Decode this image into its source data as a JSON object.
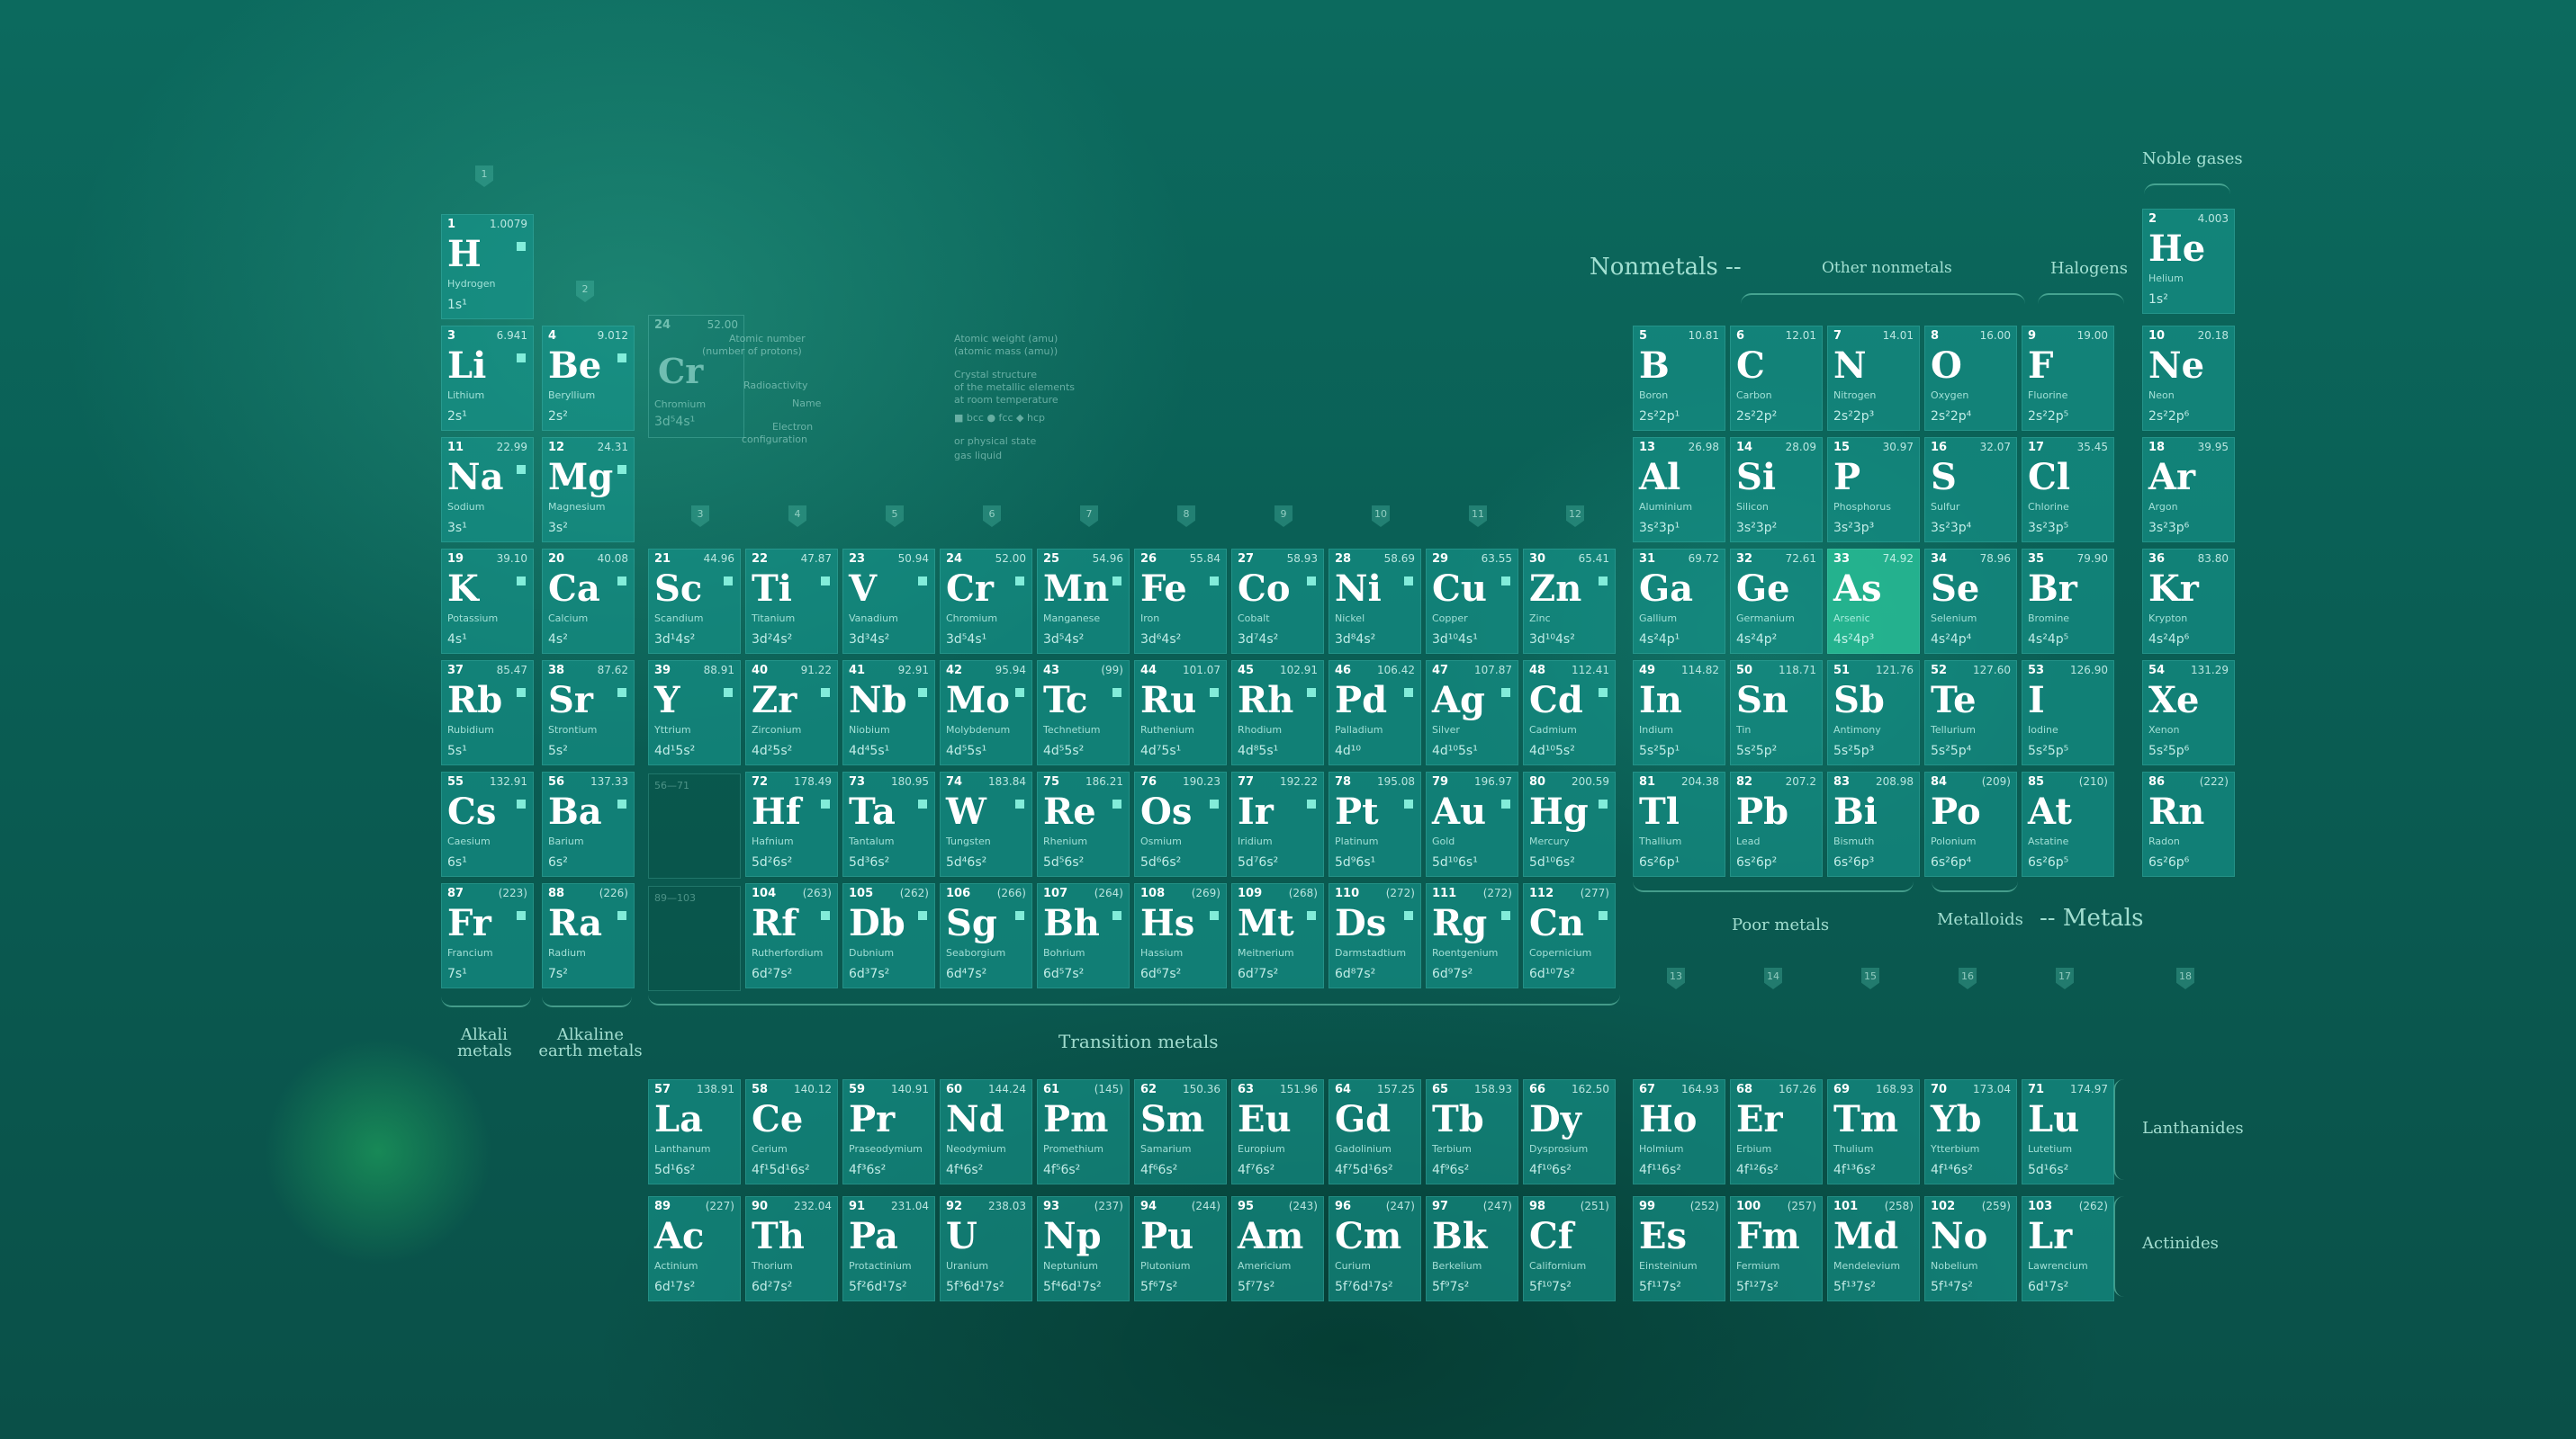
{
  "group_numbers": [
    "1",
    "2",
    "3",
    "4",
    "5",
    "6",
    "7",
    "8",
    "9",
    "10",
    "11",
    "12",
    "13",
    "14",
    "15",
    "16",
    "17",
    "18"
  ],
  "labels": {
    "noble_gases": "Noble gases",
    "nonmetals": "Nonmetals --",
    "other_nonmetals": "Other nonmetals",
    "halogens": "Halogens",
    "alkali": "Alkali metals",
    "alkaline": "Alkaline earth metals",
    "transition": "Transition metals",
    "poor": "Poor metals",
    "metalloids": "Metalloids",
    "metals": "-- Metals",
    "lanthanides": "Lanthanides",
    "actinides": "Actinides",
    "lanth_range": "56—71",
    "act_range": "89—103"
  },
  "legend": {
    "symbol": "Cr",
    "number": "24",
    "weight": "52.00",
    "name": "Chromium",
    "config": "3d⁵4s¹",
    "atomic_number": "Atomic number",
    "atomic_number_sub": "(number of protons)",
    "radioactivity": "Radioactivity",
    "name_label": "Name",
    "electron_label": "Electron",
    "configuration": "configuration",
    "atomic_weight": "Atomic weight (amu)",
    "atomic_weight_sub": "(atomic mass (amu))",
    "crystal1": "Crystal structure",
    "crystal2": "of the metallic elements",
    "crystal3": "at room temperature",
    "crystal_types": "■ bcc  ● fcc  ◆ hcp",
    "state": "or physical state",
    "state_types": "gas   liquid"
  },
  "elements": [
    {
      "n": "1",
      "s": "H",
      "name": "Hydrogen",
      "w": "1.0079",
      "e": "1s¹",
      "r": 1,
      "c": 1
    },
    {
      "n": "2",
      "s": "He",
      "name": "Helium",
      "w": "4.003",
      "e": "1s²",
      "r": 1,
      "c": 18
    },
    {
      "n": "3",
      "s": "Li",
      "name": "Lithium",
      "w": "6.941",
      "e": "2s¹",
      "r": 2,
      "c": 1
    },
    {
      "n": "4",
      "s": "Be",
      "name": "Beryllium",
      "w": "9.012",
      "e": "2s²",
      "r": 2,
      "c": 2
    },
    {
      "n": "5",
      "s": "B",
      "name": "Boron",
      "w": "10.81",
      "e": "2s²2p¹",
      "r": 2,
      "c": 13
    },
    {
      "n": "6",
      "s": "C",
      "name": "Carbon",
      "w": "12.01",
      "e": "2s²2p²",
      "r": 2,
      "c": 14
    },
    {
      "n": "7",
      "s": "N",
      "name": "Nitrogen",
      "w": "14.01",
      "e": "2s²2p³",
      "r": 2,
      "c": 15
    },
    {
      "n": "8",
      "s": "O",
      "name": "Oxygen",
      "w": "16.00",
      "e": "2s²2p⁴",
      "r": 2,
      "c": 16
    },
    {
      "n": "9",
      "s": "F",
      "name": "Fluorine",
      "w": "19.00",
      "e": "2s²2p⁵",
      "r": 2,
      "c": 17
    },
    {
      "n": "10",
      "s": "Ne",
      "name": "Neon",
      "w": "20.18",
      "e": "2s²2p⁶",
      "r": 2,
      "c": 18
    },
    {
      "n": "11",
      "s": "Na",
      "name": "Sodium",
      "w": "22.99",
      "e": "3s¹",
      "r": 3,
      "c": 1
    },
    {
      "n": "12",
      "s": "Mg",
      "name": "Magnesium",
      "w": "24.31",
      "e": "3s²",
      "r": 3,
      "c": 2
    },
    {
      "n": "13",
      "s": "Al",
      "name": "Aluminium",
      "w": "26.98",
      "e": "3s²3p¹",
      "r": 3,
      "c": 13
    },
    {
      "n": "14",
      "s": "Si",
      "name": "Silicon",
      "w": "28.09",
      "e": "3s²3p²",
      "r": 3,
      "c": 14
    },
    {
      "n": "15",
      "s": "P",
      "name": "Phosphorus",
      "w": "30.97",
      "e": "3s²3p³",
      "r": 3,
      "c": 15
    },
    {
      "n": "16",
      "s": "S",
      "name": "Sulfur",
      "w": "32.07",
      "e": "3s²3p⁴",
      "r": 3,
      "c": 16
    },
    {
      "n": "17",
      "s": "Cl",
      "name": "Chlorine",
      "w": "35.45",
      "e": "3s²3p⁵",
      "r": 3,
      "c": 17
    },
    {
      "n": "18",
      "s": "Ar",
      "name": "Argon",
      "w": "39.95",
      "e": "3s²3p⁶",
      "r": 3,
      "c": 18
    },
    {
      "n": "19",
      "s": "K",
      "name": "Potassium",
      "w": "39.10",
      "e": "4s¹",
      "r": 4,
      "c": 1
    },
    {
      "n": "20",
      "s": "Ca",
      "name": "Calcium",
      "w": "40.08",
      "e": "4s²",
      "r": 4,
      "c": 2
    },
    {
      "n": "21",
      "s": "Sc",
      "name": "Scandium",
      "w": "44.96",
      "e": "3d¹4s²",
      "r": 4,
      "c": 3
    },
    {
      "n": "22",
      "s": "Ti",
      "name": "Titanium",
      "w": "47.87",
      "e": "3d²4s²",
      "r": 4,
      "c": 4
    },
    {
      "n": "23",
      "s": "V",
      "name": "Vanadium",
      "w": "50.94",
      "e": "3d³4s²",
      "r": 4,
      "c": 5
    },
    {
      "n": "24",
      "s": "Cr",
      "name": "Chromium",
      "w": "52.00",
      "e": "3d⁵4s¹",
      "r": 4,
      "c": 6
    },
    {
      "n": "25",
      "s": "Mn",
      "name": "Manganese",
      "w": "54.96",
      "e": "3d⁵4s²",
      "r": 4,
      "c": 7
    },
    {
      "n": "26",
      "s": "Fe",
      "name": "Iron",
      "w": "55.84",
      "e": "3d⁶4s²",
      "r": 4,
      "c": 8
    },
    {
      "n": "27",
      "s": "Co",
      "name": "Cobalt",
      "w": "58.93",
      "e": "3d⁷4s²",
      "r": 4,
      "c": 9
    },
    {
      "n": "28",
      "s": "Ni",
      "name": "Nickel",
      "w": "58.69",
      "e": "3d⁸4s²",
      "r": 4,
      "c": 10
    },
    {
      "n": "29",
      "s": "Cu",
      "name": "Copper",
      "w": "63.55",
      "e": "3d¹⁰4s¹",
      "r": 4,
      "c": 11
    },
    {
      "n": "30",
      "s": "Zn",
      "name": "Zinc",
      "w": "65.41",
      "e": "3d¹⁰4s²",
      "r": 4,
      "c": 12
    },
    {
      "n": "31",
      "s": "Ga",
      "name": "Gallium",
      "w": "69.72",
      "e": "4s²4p¹",
      "r": 4,
      "c": 13
    },
    {
      "n": "32",
      "s": "Ge",
      "name": "Germanium",
      "w": "72.61",
      "e": "4s²4p²",
      "r": 4,
      "c": 14
    },
    {
      "n": "33",
      "s": "As",
      "name": "Arsenic",
      "w": "74.92",
      "e": "4s²4p³",
      "r": 4,
      "c": 15,
      "hl": true
    },
    {
      "n": "34",
      "s": "Se",
      "name": "Selenium",
      "w": "78.96",
      "e": "4s²4p⁴",
      "r": 4,
      "c": 16
    },
    {
      "n": "35",
      "s": "Br",
      "name": "Bromine",
      "w": "79.90",
      "e": "4s²4p⁵",
      "r": 4,
      "c": 17
    },
    {
      "n": "36",
      "s": "Kr",
      "name": "Krypton",
      "w": "83.80",
      "e": "4s²4p⁶",
      "r": 4,
      "c": 18
    },
    {
      "n": "37",
      "s": "Rb",
      "name": "Rubidium",
      "w": "85.47",
      "e": "5s¹",
      "r": 5,
      "c": 1
    },
    {
      "n": "38",
      "s": "Sr",
      "name": "Strontium",
      "w": "87.62",
      "e": "5s²",
      "r": 5,
      "c": 2
    },
    {
      "n": "39",
      "s": "Y",
      "name": "Yttrium",
      "w": "88.91",
      "e": "4d¹5s²",
      "r": 5,
      "c": 3
    },
    {
      "n": "40",
      "s": "Zr",
      "name": "Zirconium",
      "w": "91.22",
      "e": "4d²5s²",
      "r": 5,
      "c": 4
    },
    {
      "n": "41",
      "s": "Nb",
      "name": "Niobium",
      "w": "92.91",
      "e": "4d⁴5s¹",
      "r": 5,
      "c": 5
    },
    {
      "n": "42",
      "s": "Mo",
      "name": "Molybdenum",
      "w": "95.94",
      "e": "4d⁵5s¹",
      "r": 5,
      "c": 6
    },
    {
      "n": "43",
      "s": "Tc",
      "name": "Technetium",
      "w": "(99)",
      "e": "4d⁵5s²",
      "r": 5,
      "c": 7
    },
    {
      "n": "44",
      "s": "Ru",
      "name": "Ruthenium",
      "w": "101.07",
      "e": "4d⁷5s¹",
      "r": 5,
      "c": 8
    },
    {
      "n": "45",
      "s": "Rh",
      "name": "Rhodium",
      "w": "102.91",
      "e": "4d⁸5s¹",
      "r": 5,
      "c": 9
    },
    {
      "n": "46",
      "s": "Pd",
      "name": "Palladium",
      "w": "106.42",
      "e": "4d¹⁰",
      "r": 5,
      "c": 10
    },
    {
      "n": "47",
      "s": "Ag",
      "name": "Silver",
      "w": "107.87",
      "e": "4d¹⁰5s¹",
      "r": 5,
      "c": 11
    },
    {
      "n": "48",
      "s": "Cd",
      "name": "Cadmium",
      "w": "112.41",
      "e": "4d¹⁰5s²",
      "r": 5,
      "c": 12
    },
    {
      "n": "49",
      "s": "In",
      "name": "Indium",
      "w": "114.82",
      "e": "5s²5p¹",
      "r": 5,
      "c": 13
    },
    {
      "n": "50",
      "s": "Sn",
      "name": "Tin",
      "w": "118.71",
      "e": "5s²5p²",
      "r": 5,
      "c": 14
    },
    {
      "n": "51",
      "s": "Sb",
      "name": "Antimony",
      "w": "121.76",
      "e": "5s²5p³",
      "r": 5,
      "c": 15
    },
    {
      "n": "52",
      "s": "Te",
      "name": "Tellurium",
      "w": "127.60",
      "e": "5s²5p⁴",
      "r": 5,
      "c": 16
    },
    {
      "n": "53",
      "s": "I",
      "name": "Iodine",
      "w": "126.90",
      "e": "5s²5p⁵",
      "r": 5,
      "c": 17
    },
    {
      "n": "54",
      "s": "Xe",
      "name": "Xenon",
      "w": "131.29",
      "e": "5s²5p⁶",
      "r": 5,
      "c": 18
    },
    {
      "n": "55",
      "s": "Cs",
      "name": "Caesium",
      "w": "132.91",
      "e": "6s¹",
      "r": 6,
      "c": 1
    },
    {
      "n": "56",
      "s": "Ba",
      "name": "Barium",
      "w": "137.33",
      "e": "6s²",
      "r": 6,
      "c": 2
    },
    {
      "n": "72",
      "s": "Hf",
      "name": "Hafnium",
      "w": "178.49",
      "e": "5d²6s²",
      "r": 6,
      "c": 4
    },
    {
      "n": "73",
      "s": "Ta",
      "name": "Tantalum",
      "w": "180.95",
      "e": "5d³6s²",
      "r": 6,
      "c": 5
    },
    {
      "n": "74",
      "s": "W",
      "name": "Tungsten",
      "w": "183.84",
      "e": "5d⁴6s²",
      "r": 6,
      "c": 6
    },
    {
      "n": "75",
      "s": "Re",
      "name": "Rhenium",
      "w": "186.21",
      "e": "5d⁵6s²",
      "r": 6,
      "c": 7
    },
    {
      "n": "76",
      "s": "Os",
      "name": "Osmium",
      "w": "190.23",
      "e": "5d⁶6s²",
      "r": 6,
      "c": 8
    },
    {
      "n": "77",
      "s": "Ir",
      "name": "Iridium",
      "w": "192.22",
      "e": "5d⁷6s²",
      "r": 6,
      "c": 9
    },
    {
      "n": "78",
      "s": "Pt",
      "name": "Platinum",
      "w": "195.08",
      "e": "5d⁹6s¹",
      "r": 6,
      "c": 10
    },
    {
      "n": "79",
      "s": "Au",
      "name": "Gold",
      "w": "196.97",
      "e": "5d¹⁰6s¹",
      "r": 6,
      "c": 11
    },
    {
      "n": "80",
      "s": "Hg",
      "name": "Mercury",
      "w": "200.59",
      "e": "5d¹⁰6s²",
      "r": 6,
      "c": 12
    },
    {
      "n": "81",
      "s": "Tl",
      "name": "Thallium",
      "w": "204.38",
      "e": "6s²6p¹",
      "r": 6,
      "c": 13
    },
    {
      "n": "82",
      "s": "Pb",
      "name": "Lead",
      "w": "207.2",
      "e": "6s²6p²",
      "r": 6,
      "c": 14
    },
    {
      "n": "83",
      "s": "Bi",
      "name": "Bismuth",
      "w": "208.98",
      "e": "6s²6p³",
      "r": 6,
      "c": 15
    },
    {
      "n": "84",
      "s": "Po",
      "name": "Polonium",
      "w": "(209)",
      "e": "6s²6p⁴",
      "r": 6,
      "c": 16
    },
    {
      "n": "85",
      "s": "At",
      "name": "Astatine",
      "w": "(210)",
      "e": "6s²6p⁵",
      "r": 6,
      "c": 17
    },
    {
      "n": "86",
      "s": "Rn",
      "name": "Radon",
      "w": "(222)",
      "e": "6s²6p⁶",
      "r": 6,
      "c": 18
    },
    {
      "n": "87",
      "s": "Fr",
      "name": "Francium",
      "w": "(223)",
      "e": "7s¹",
      "r": 7,
      "c": 1
    },
    {
      "n": "88",
      "s": "Ra",
      "name": "Radium",
      "w": "(226)",
      "e": "7s²",
      "r": 7,
      "c": 2
    },
    {
      "n": "104",
      "s": "Rf",
      "name": "Rutherfordium",
      "w": "(263)",
      "e": "6d²7s²",
      "r": 7,
      "c": 4
    },
    {
      "n": "105",
      "s": "Db",
      "name": "Dubnium",
      "w": "(262)",
      "e": "6d³7s²",
      "r": 7,
      "c": 5
    },
    {
      "n": "106",
      "s": "Sg",
      "name": "Seaborgium",
      "w": "(266)",
      "e": "6d⁴7s²",
      "r": 7,
      "c": 6
    },
    {
      "n": "107",
      "s": "Bh",
      "name": "Bohrium",
      "w": "(264)",
      "e": "6d⁵7s²",
      "r": 7,
      "c": 7
    },
    {
      "n": "108",
      "s": "Hs",
      "name": "Hassium",
      "w": "(269)",
      "e": "6d⁶7s²",
      "r": 7,
      "c": 8
    },
    {
      "n": "109",
      "s": "Mt",
      "name": "Meitnerium",
      "w": "(268)",
      "e": "6d⁷7s²",
      "r": 7,
      "c": 9
    },
    {
      "n": "110",
      "s": "Ds",
      "name": "Darmstadtium",
      "w": "(272)",
      "e": "6d⁸7s²",
      "r": 7,
      "c": 10
    },
    {
      "n": "111",
      "s": "Rg",
      "name": "Roentgenium",
      "w": "(272)",
      "e": "6d⁹7s²",
      "r": 7,
      "c": 11
    },
    {
      "n": "112",
      "s": "Cn",
      "name": "Copernicium",
      "w": "(277)",
      "e": "6d¹⁰7s²",
      "r": 7,
      "c": 12
    },
    {
      "n": "57",
      "s": "La",
      "name": "Lanthanum",
      "w": "138.91",
      "e": "5d¹6s²",
      "r": 9,
      "c": 3
    },
    {
      "n": "58",
      "s": "Ce",
      "name": "Cerium",
      "w": "140.12",
      "e": "4f¹5d¹6s²",
      "r": 9,
      "c": 4
    },
    {
      "n": "59",
      "s": "Pr",
      "name": "Praseodymium",
      "w": "140.91",
      "e": "4f³6s²",
      "r": 9,
      "c": 5
    },
    {
      "n": "60",
      "s": "Nd",
      "name": "Neodymium",
      "w": "144.24",
      "e": "4f⁴6s²",
      "r": 9,
      "c": 6
    },
    {
      "n": "61",
      "s": "Pm",
      "name": "Promethium",
      "w": "(145)",
      "e": "4f⁵6s²",
      "r": 9,
      "c": 7
    },
    {
      "n": "62",
      "s": "Sm",
      "name": "Samarium",
      "w": "150.36",
      "e": "4f⁶6s²",
      "r": 9,
      "c": 8
    },
    {
      "n": "63",
      "s": "Eu",
      "name": "Europium",
      "w": "151.96",
      "e": "4f⁷6s²",
      "r": 9,
      "c": 9
    },
    {
      "n": "64",
      "s": "Gd",
      "name": "Gadolinium",
      "w": "157.25",
      "e": "4f⁷5d¹6s²",
      "r": 9,
      "c": 10
    },
    {
      "n": "65",
      "s": "Tb",
      "name": "Terbium",
      "w": "158.93",
      "e": "4f⁹6s²",
      "r": 9,
      "c": 11
    },
    {
      "n": "66",
      "s": "Dy",
      "name": "Dysprosium",
      "w": "162.50",
      "e": "4f¹⁰6s²",
      "r": 9,
      "c": 12
    },
    {
      "n": "67",
      "s": "Ho",
      "name": "Holmium",
      "w": "164.93",
      "e": "4f¹¹6s²",
      "r": 9,
      "c": 13
    },
    {
      "n": "68",
      "s": "Er",
      "name": "Erbium",
      "w": "167.26",
      "e": "4f¹²6s²",
      "r": 9,
      "c": 14
    },
    {
      "n": "69",
      "s": "Tm",
      "name": "Thulium",
      "w": "168.93",
      "e": "4f¹³6s²",
      "r": 9,
      "c": 15
    },
    {
      "n": "70",
      "s": "Yb",
      "name": "Ytterbium",
      "w": "173.04",
      "e": "4f¹⁴6s²",
      "r": 9,
      "c": 16
    },
    {
      "n": "71",
      "s": "Lu",
      "name": "Lutetium",
      "w": "174.97",
      "e": "5d¹6s²",
      "r": 9,
      "c": 17
    },
    {
      "n": "89",
      "s": "Ac",
      "name": "Actinium",
      "w": "(227)",
      "e": "6d¹7s²",
      "r": 10,
      "c": 3
    },
    {
      "n": "90",
      "s": "Th",
      "name": "Thorium",
      "w": "232.04",
      "e": "6d²7s²",
      "r": 10,
      "c": 4
    },
    {
      "n": "91",
      "s": "Pa",
      "name": "Protactinium",
      "w": "231.04",
      "e": "5f²6d¹7s²",
      "r": 10,
      "c": 5
    },
    {
      "n": "92",
      "s": "U",
      "name": "Uranium",
      "w": "238.03",
      "e": "5f³6d¹7s²",
      "r": 10,
      "c": 6
    },
    {
      "n": "93",
      "s": "Np",
      "name": "Neptunium",
      "w": "(237)",
      "e": "5f⁴6d¹7s²",
      "r": 10,
      "c": 7
    },
    {
      "n": "94",
      "s": "Pu",
      "name": "Plutonium",
      "w": "(244)",
      "e": "5f⁶7s²",
      "r": 10,
      "c": 8
    },
    {
      "n": "95",
      "s": "Am",
      "name": "Americium",
      "w": "(243)",
      "e": "5f⁷7s²",
      "r": 10,
      "c": 9
    },
    {
      "n": "96",
      "s": "Cm",
      "name": "Curium",
      "w": "(247)",
      "e": "5f⁷6d¹7s²",
      "r": 10,
      "c": 10
    },
    {
      "n": "97",
      "s": "Bk",
      "name": "Berkelium",
      "w": "(247)",
      "e": "5f⁹7s²",
      "r": 10,
      "c": 11
    },
    {
      "n": "98",
      "s": "Cf",
      "name": "Californium",
      "w": "(251)",
      "e": "5f¹⁰7s²",
      "r": 10,
      "c": 12
    },
    {
      "n": "99",
      "s": "Es",
      "name": "Einsteinium",
      "w": "(252)",
      "e": "5f¹¹7s²",
      "r": 10,
      "c": 13
    },
    {
      "n": "100",
      "s": "Fm",
      "name": "Fermium",
      "w": "(257)",
      "e": "5f¹²7s²",
      "r": 10,
      "c": 14
    },
    {
      "n": "101",
      "s": "Md",
      "name": "Mendelevium",
      "w": "(258)",
      "e": "5f¹³7s²",
      "r": 10,
      "c": 15
    },
    {
      "n": "102",
      "s": "No",
      "name": "Nobelium",
      "w": "(259)",
      "e": "5f¹⁴7s²",
      "r": 10,
      "c": 16
    },
    {
      "n": "103",
      "s": "Lr",
      "name": "Lawrencium",
      "w": "(262)",
      "e": "6d¹7s²",
      "r": 10,
      "c": 17
    }
  ]
}
